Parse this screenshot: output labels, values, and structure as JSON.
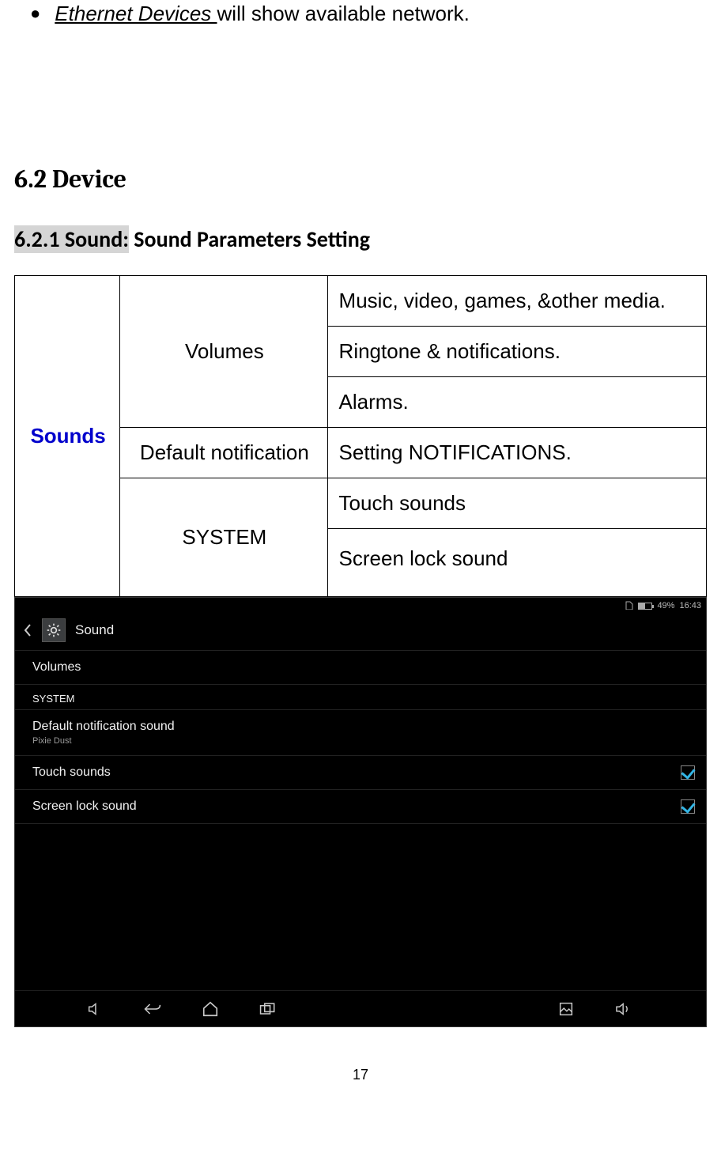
{
  "bullet": {
    "link_text": "Ethernet Devices ",
    "rest": "will show available network."
  },
  "heading_device": "6.2 Device",
  "heading_sound_num": "6.2.1 Sound:",
  "heading_sound_rest": " Sound Parameters Setting",
  "table": {
    "rowhead": "Sounds",
    "c1": "Volumes",
    "c2": "Default notification",
    "c3": "SYSTEM",
    "r1": "Music, video, games, &other media.",
    "r2": "Ringtone & notifications.",
    "r3": "Alarms.",
    "r4": "Setting NOTIFICATIONS.",
    "r5": "Touch sounds",
    "r6": "Screen lock sound"
  },
  "android": {
    "battery_pct": "49%",
    "clock": "16:43",
    "title": "Sound",
    "items": {
      "volumes": "Volumes",
      "system_cat": "SYSTEM",
      "default_notif": "Default notification sound",
      "default_notif_sub": "Pixie Dust",
      "touch": "Touch sounds",
      "lock": "Screen lock sound"
    }
  },
  "page_number": "17"
}
